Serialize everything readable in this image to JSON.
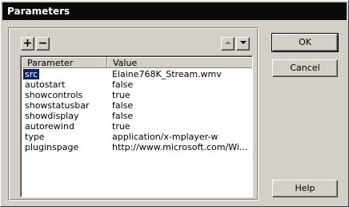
{
  "window": {
    "title": "Parameters"
  },
  "toolbar": {
    "add_label": "+",
    "remove_label": "−"
  },
  "grid": {
    "headers": [
      "Parameter",
      "Value"
    ],
    "rows": [
      {
        "param": "src",
        "value": "Elaine768K_Stream.wmv"
      },
      {
        "param": "autostart",
        "value": "false"
      },
      {
        "param": "showcontrols",
        "value": "true"
      },
      {
        "param": "showstatusbar",
        "value": "false"
      },
      {
        "param": "showdisplay",
        "value": "false"
      },
      {
        "param": "autorewind",
        "value": "true"
      },
      {
        "param": "type",
        "value": "application/x-mplayer-w"
      },
      {
        "param": "pluginspage",
        "value": "http://www.microsoft.com/Wi..."
      }
    ]
  },
  "buttons": {
    "ok": "OK",
    "cancel": "Cancel",
    "help": "Help"
  }
}
